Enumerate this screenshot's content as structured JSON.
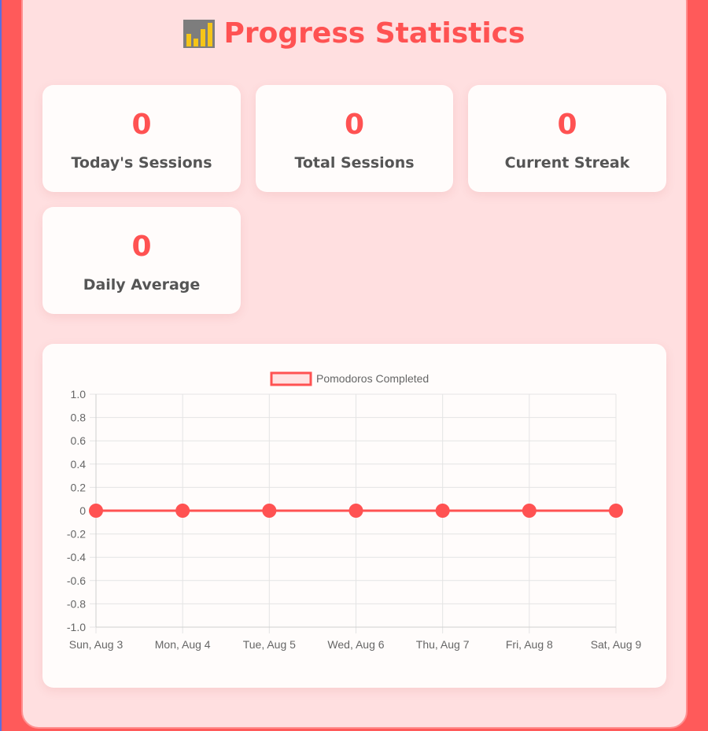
{
  "header": {
    "title": "Progress Statistics",
    "icon": "bar-chart-icon"
  },
  "stats": [
    {
      "value": "0",
      "label": "Today's Sessions"
    },
    {
      "value": "0",
      "label": "Total Sessions"
    },
    {
      "value": "0",
      "label": "Current Streak"
    },
    {
      "value": "0",
      "label": "Daily Average"
    }
  ],
  "colors": {
    "accent": "#ff5252",
    "background": "#ffdfe0",
    "card": "#fffcfb"
  },
  "chart_data": {
    "type": "line",
    "categories": [
      "Sun, Aug 3",
      "Mon, Aug 4",
      "Tue, Aug 5",
      "Wed, Aug 6",
      "Thu, Aug 7",
      "Fri, Aug 8",
      "Sat, Aug 9"
    ],
    "series": [
      {
        "name": "Pomodoros Completed",
        "values": [
          0,
          0,
          0,
          0,
          0,
          0,
          0
        ],
        "color": "#ff5252"
      }
    ],
    "ylim": [
      -1.0,
      1.0
    ],
    "yticks": [
      "1.0",
      "0.8",
      "0.6",
      "0.4",
      "0.2",
      "0",
      "-0.2",
      "-0.4",
      "-0.6",
      "-0.8",
      "-1.0"
    ],
    "grid": true,
    "legend": "top-center",
    "title": "",
    "xlabel": "",
    "ylabel": ""
  }
}
